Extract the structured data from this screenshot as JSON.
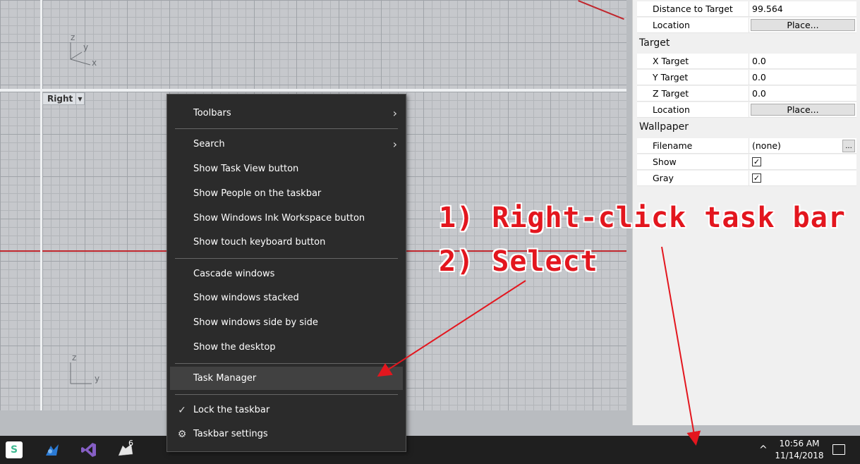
{
  "viewports": {
    "right_label": "Right",
    "top_axes": {
      "z": "z",
      "y": "y",
      "x": "x"
    },
    "right_axes": {
      "z": "z",
      "y": "y"
    }
  },
  "properties": {
    "camera_rows": [
      {
        "key": "Distance to Target",
        "value": "99.564"
      },
      {
        "key": "Location",
        "button": "Place..."
      }
    ],
    "target_title": "Target",
    "target_rows": [
      {
        "key": "X Target",
        "value": "0.0"
      },
      {
        "key": "Y Target",
        "value": "0.0"
      },
      {
        "key": "Z Target",
        "value": "0.0"
      },
      {
        "key": "Location",
        "button": "Place..."
      }
    ],
    "wallpaper_title": "Wallpaper",
    "wallpaper_rows": [
      {
        "key": "Filename",
        "value": "(none)",
        "button": "..."
      },
      {
        "key": "Show",
        "checked": "✓"
      },
      {
        "key": "Gray",
        "checked": "✓"
      }
    ]
  },
  "context_menu": {
    "items": [
      {
        "label": "Toolbars",
        "submenu": "›"
      },
      {
        "label": "Search",
        "submenu": "›"
      },
      {
        "label": "Show Task View button"
      },
      {
        "label": "Show People on the taskbar"
      },
      {
        "label": "Show Windows Ink Workspace button"
      },
      {
        "label": "Show touch keyboard button"
      },
      {
        "label": "Cascade windows"
      },
      {
        "label": "Show windows stacked"
      },
      {
        "label": "Show windows side by side"
      },
      {
        "label": "Show the desktop"
      },
      {
        "label": "Task Manager"
      },
      {
        "label": "Lock the taskbar",
        "prefix": "✓"
      },
      {
        "label": "Taskbar settings",
        "prefix": "⚙"
      }
    ]
  },
  "annotations": {
    "step1": "1) Right-click task bar",
    "step2": "2) Select"
  },
  "taskbar": {
    "apps": [
      {
        "icon": "slack-icon",
        "color": "#3eb991",
        "letter": "S"
      },
      {
        "icon": "grasshopper-icon",
        "color": "#2a7ad5"
      },
      {
        "icon": "visual-studio-icon",
        "color": "#865fc5"
      },
      {
        "icon": "rhino-icon",
        "color": "#dddddd",
        "badge": "6"
      }
    ],
    "tray_chevron": "^",
    "time": "10:56 AM",
    "date": "11/14/2018"
  },
  "colors": {
    "annotation_red": "#e3161e",
    "menu_bg": "#2b2b2b",
    "taskbar_bg": "#1f1f1f",
    "axis_red": "#c0262d"
  }
}
